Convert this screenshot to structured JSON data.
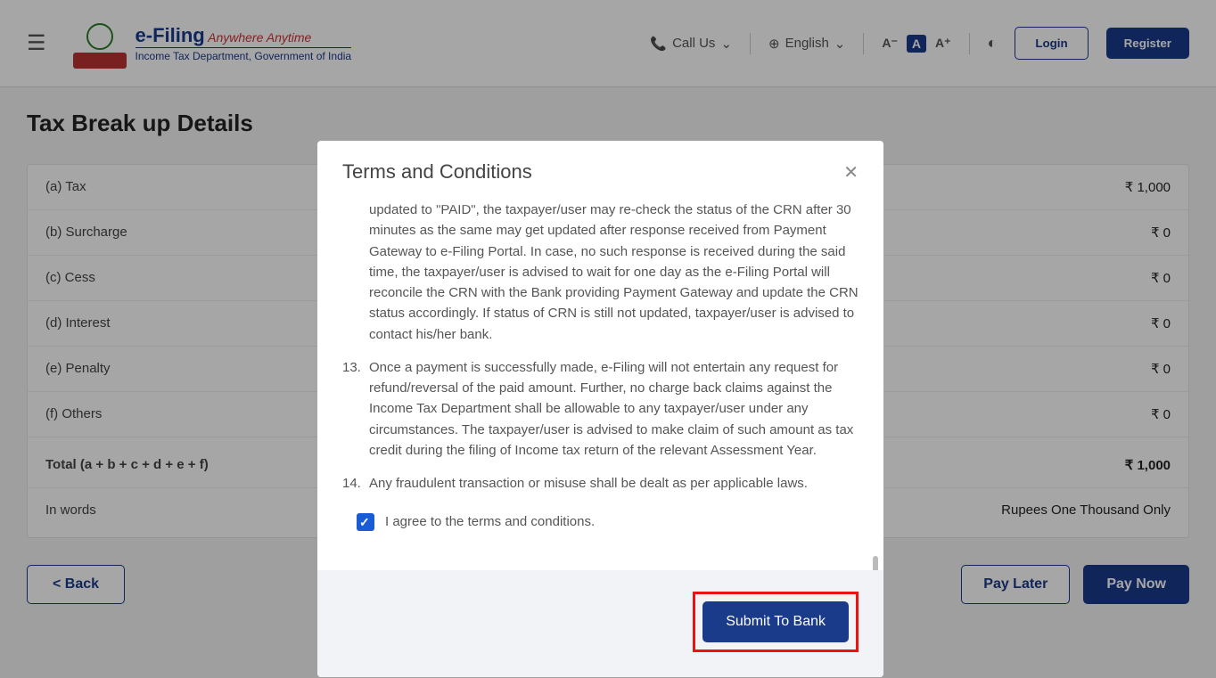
{
  "header": {
    "logo_title_blue": "e-Filing",
    "logo_title_red": " Anywhere Anytime",
    "logo_sub": "Income Tax Department, Government of India",
    "call_us": "Call Us",
    "language": "English",
    "login": "Login",
    "register": "Register",
    "font_minus": "A⁻",
    "font_normal": "A",
    "font_plus": "A⁺"
  },
  "page_title": "Tax Break up Details",
  "rows": [
    {
      "label": "(a) Tax",
      "value": "₹ 1,000"
    },
    {
      "label": "(b) Surcharge",
      "value": "₹ 0"
    },
    {
      "label": "(c) Cess",
      "value": "₹ 0"
    },
    {
      "label": "(d) Interest",
      "value": "₹ 0"
    },
    {
      "label": "(e) Penalty",
      "value": "₹ 0"
    },
    {
      "label": "(f) Others",
      "value": "₹ 0"
    }
  ],
  "total": {
    "label": "Total (a + b + c + d + e + f)",
    "value": "₹ 1,000"
  },
  "words": {
    "label": "In words",
    "value": "Rupees One Thousand Only"
  },
  "buttons": {
    "back": "< Back",
    "pay_later": "Pay Later",
    "pay_now": "Pay Now"
  },
  "modal": {
    "title": "Terms and Conditions",
    "partial_text": "updated to \"PAID\", the taxpayer/user may re-check the status of the CRN after 30 minutes as the same may get updated after response received from Payment Gateway to e-Filing Portal. In case, no such response is received during the said time, the taxpayer/user is advised to wait for one day as the e-Filing Portal will reconcile the CRN with the Bank providing Payment Gateway and update the CRN status accordingly. If status of CRN is still not updated, taxpayer/user is advised to contact his/her bank.",
    "item13_num": "13.",
    "item13": "Once a payment is successfully made, e-Filing will not entertain any request for refund/reversal of the paid amount. Further, no charge back claims against the Income Tax Department shall be allowable to any taxpayer/user under any circumstances. The taxpayer/user is advised to make claim of such amount as tax credit during the filing of Income tax return of the relevant Assessment Year.",
    "item14_num": "14.",
    "item14": "Any fraudulent transaction or misuse shall be dealt as per applicable laws.",
    "agree": "I agree to the terms and conditions.",
    "submit": "Submit To Bank"
  }
}
